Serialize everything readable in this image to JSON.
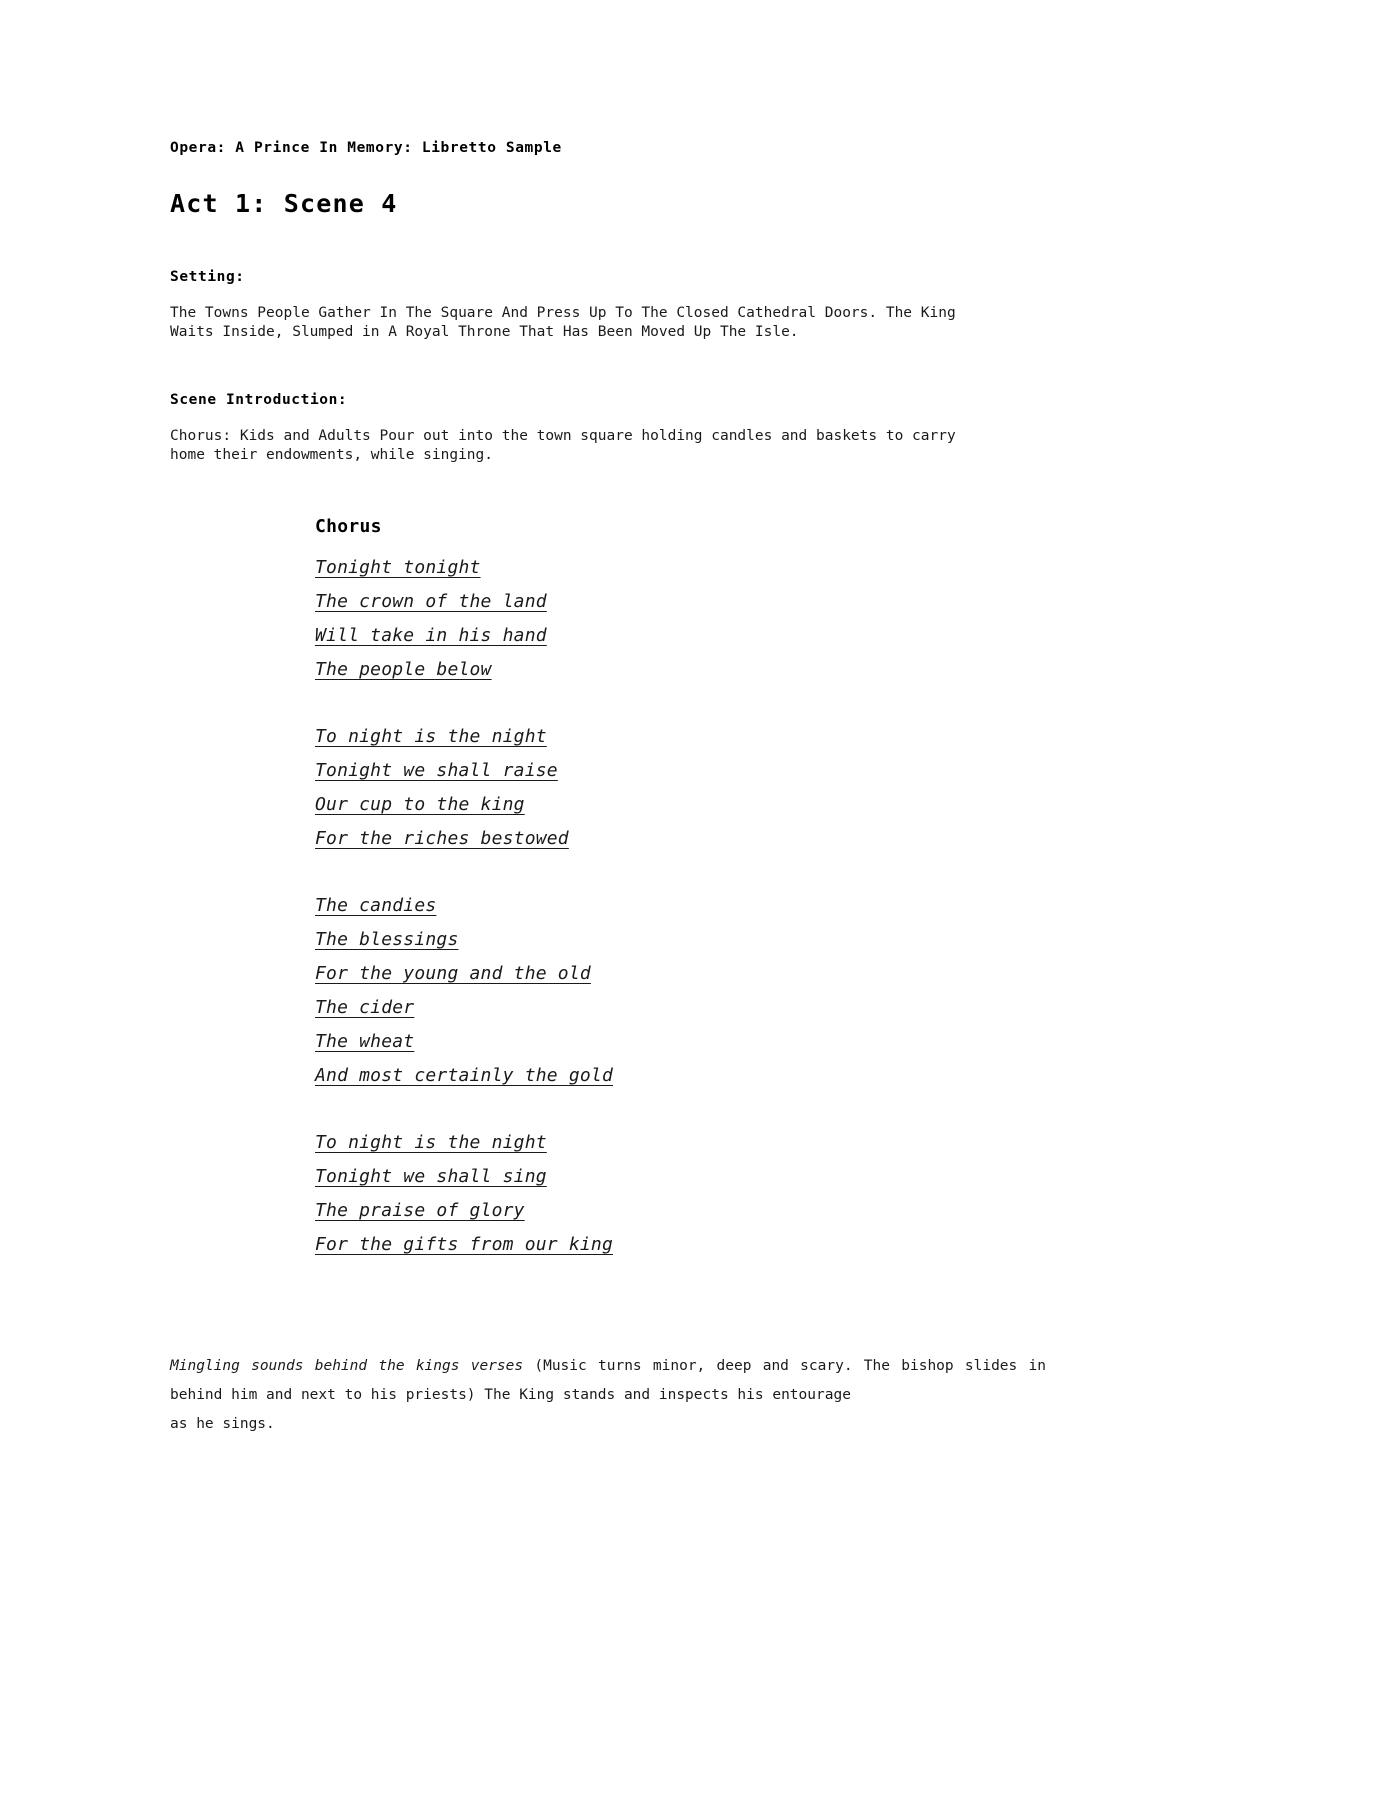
{
  "document": {
    "title": "Opera: A Prince In Memory: Libretto Sample",
    "act_heading": "Act 1: Scene 4",
    "setting": {
      "label": "Setting:",
      "text": "The Towns People Gather In The Square And Press Up To The Closed Cathedral Doors. The King Waits Inside, Slumped in A Royal Throne That Has Been Moved Up The Isle.",
      "line1": "The Towns People Gather In The Square And Press Up To The Closed Cathedral Doors. The King",
      "line2": "Waits Inside, Slumped in A Royal Throne That Has Been Moved Up The Isle."
    },
    "scene_introduction": {
      "label": "Scene Introduction:",
      "text": "Chorus: Kids and Adults Pour out into the town square holding candles and baskets to carry home their endowments, while singing.",
      "line1": "Chorus: Kids and Adults Pour out into the town square holding candles and baskets to carry",
      "line2": "home their endowments, while singing."
    },
    "lyrics": {
      "speaker": "Chorus",
      "stanzas": [
        {
          "lines": [
            "Tonight tonight",
            "The crown of the land",
            "Will take in his hand",
            "The people below"
          ]
        },
        {
          "lines": [
            "To night is the night",
            "Tonight we shall raise",
            "Our cup to the king",
            "For the riches bestowed"
          ]
        },
        {
          "lines": [
            "The candies",
            "The blessings",
            "For the young and the old",
            "The cider",
            "The wheat",
            "And most certainly the gold"
          ]
        },
        {
          "lines": [
            "To night is the night",
            "Tonight we shall sing",
            "The praise of glory",
            "For the gifts from our king"
          ]
        }
      ]
    },
    "closing": {
      "cue": "Mingling sounds behind the kings verses",
      "text": " (Music turns minor, deep and scary. The bishop slides in behind him and next to his priests) The King stands and inspects his entourage",
      "last_line": "as he sings."
    }
  }
}
